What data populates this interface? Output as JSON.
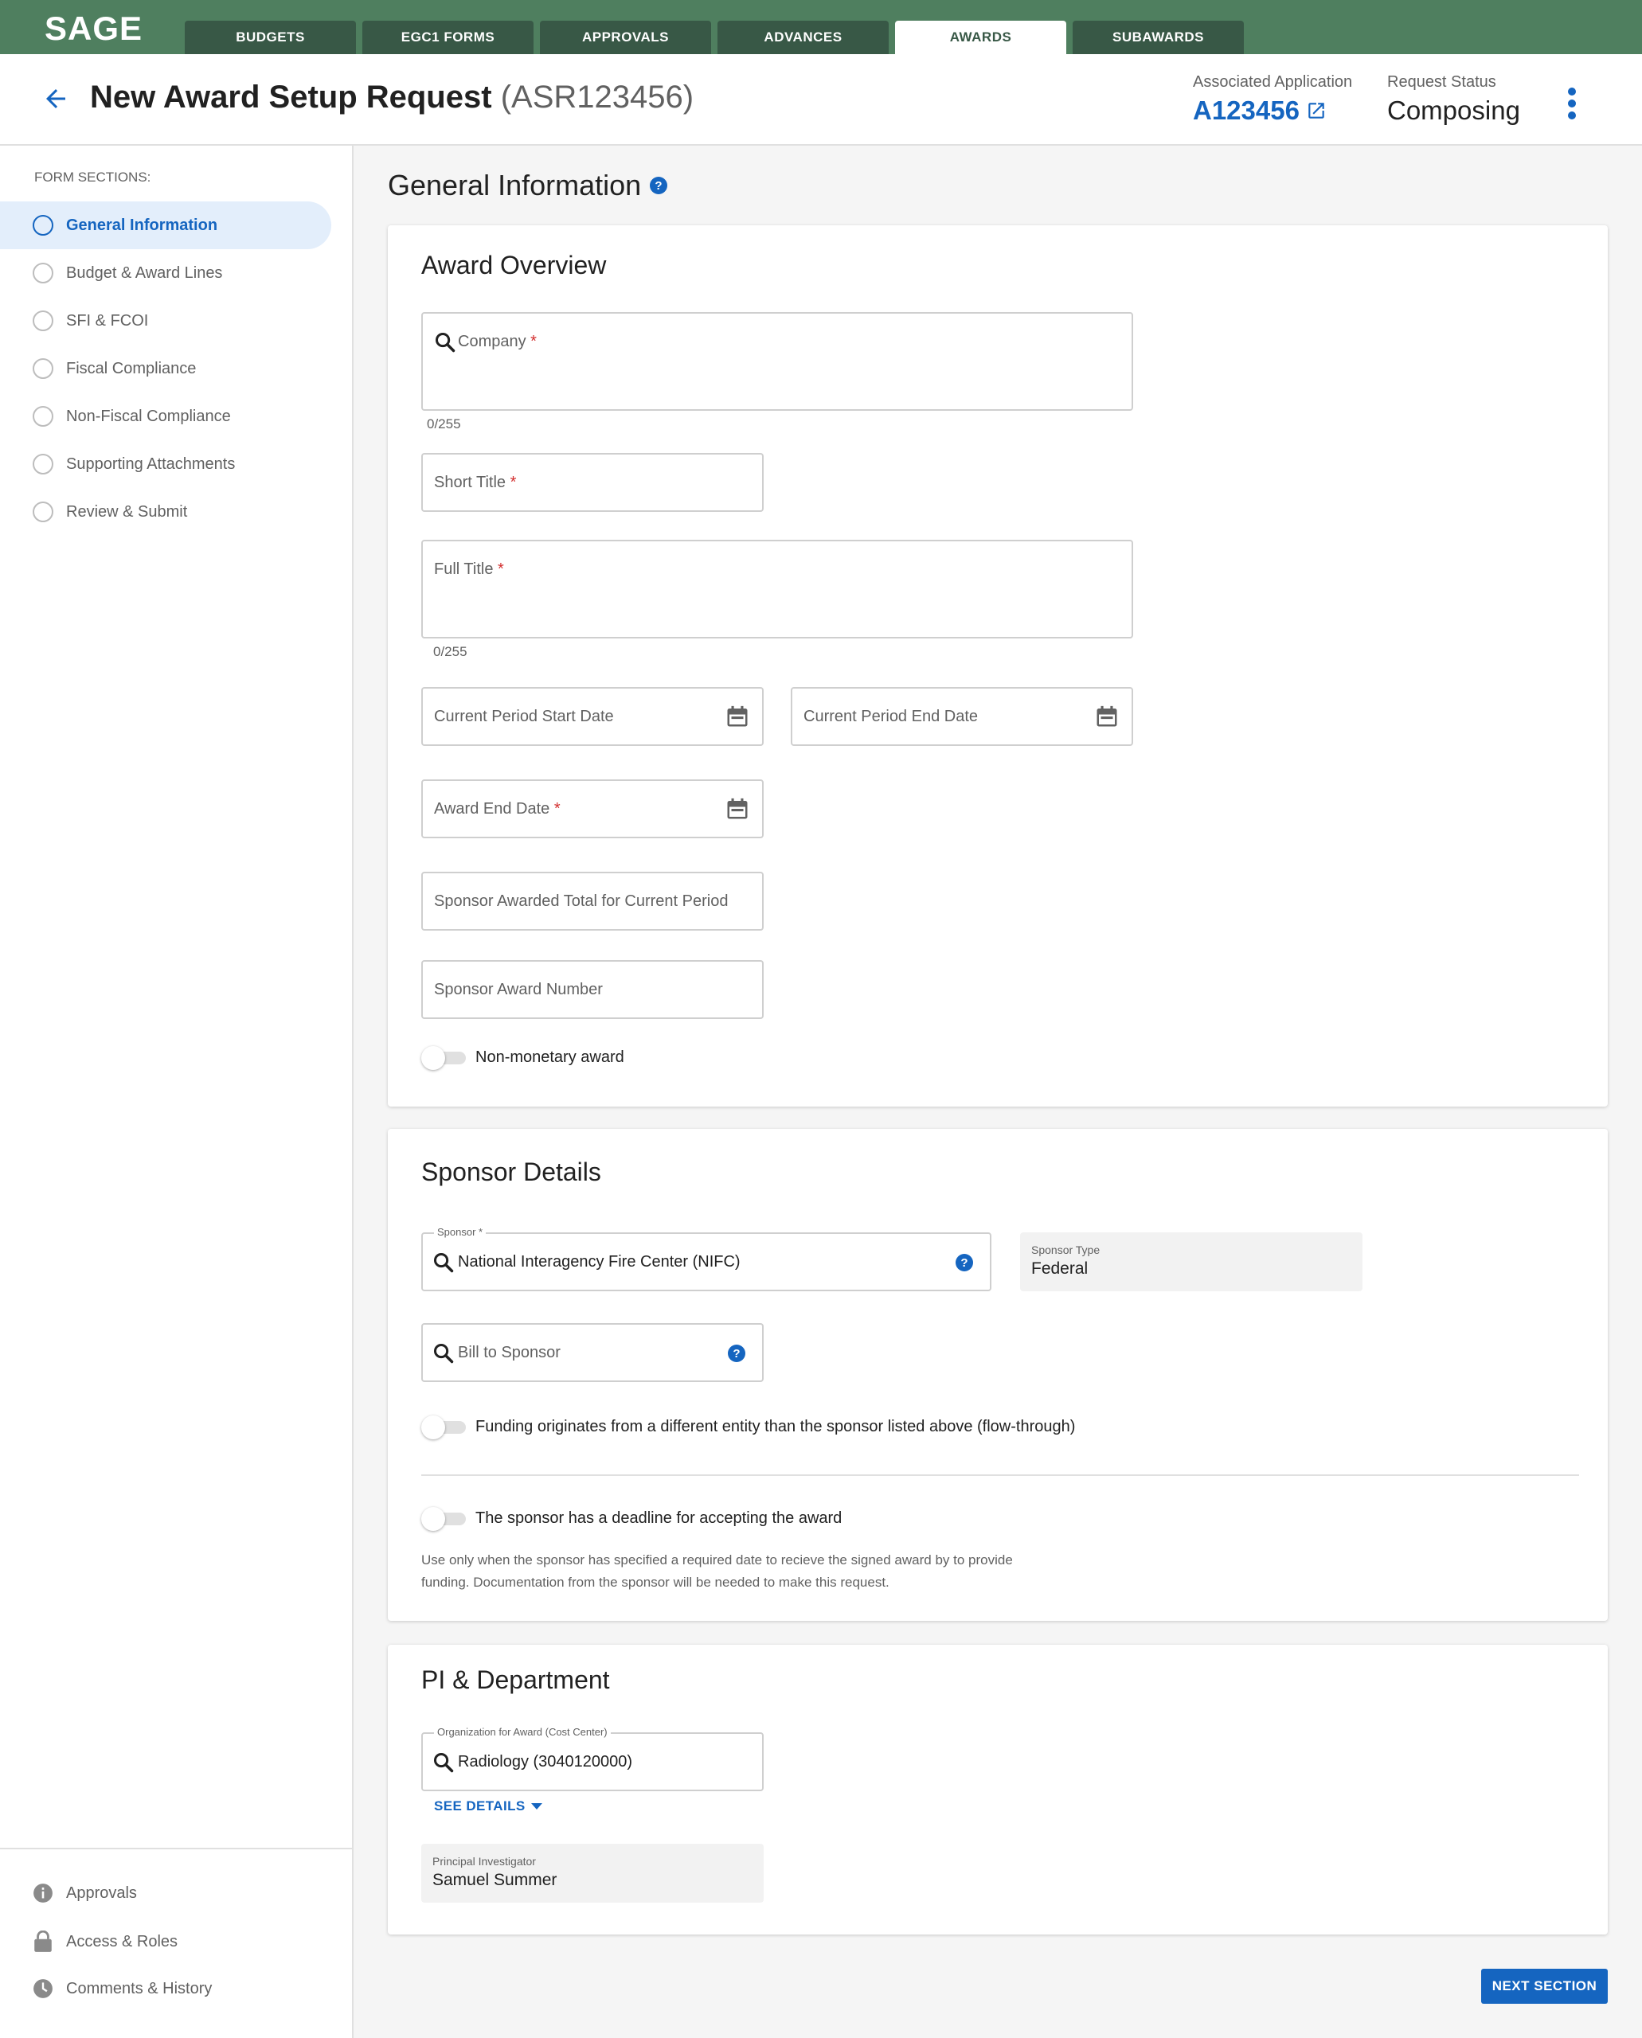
{
  "app": {
    "logo": "SAGE"
  },
  "nav": {
    "tabs": [
      {
        "label": "BUDGETS"
      },
      {
        "label": "EGC1 FORMS"
      },
      {
        "label": "APPROVALS"
      },
      {
        "label": "ADVANCES"
      },
      {
        "label": "AWARDS"
      },
      {
        "label": "SUBAWARDS"
      }
    ],
    "active_tab": "AWARDS"
  },
  "header": {
    "title": "New Award Setup Request",
    "request_id": "(ASR123456)",
    "associated_label": "Associated Application",
    "associated_value": "A123456",
    "status_label": "Request Status",
    "status_value": "Composing"
  },
  "sidebar": {
    "heading": "FORM SECTIONS:",
    "items": [
      {
        "label": "General Information",
        "active": true
      },
      {
        "label": "Budget & Award Lines"
      },
      {
        "label": "SFI & FCOI"
      },
      {
        "label": "Fiscal Compliance"
      },
      {
        "label": "Non-Fiscal Compliance"
      },
      {
        "label": "Supporting Attachments"
      },
      {
        "label": "Review & Submit"
      }
    ],
    "bottom": [
      {
        "label": "Approvals",
        "icon": "info-icon"
      },
      {
        "label": "Access & Roles",
        "icon": "lock-icon"
      },
      {
        "label": "Comments & History",
        "icon": "clock-icon"
      }
    ]
  },
  "main": {
    "section_title": "General Information",
    "overview": {
      "title": "Award Overview",
      "company_label": "Company",
      "company_counter": "0/255",
      "short_title_label": "Short Title",
      "full_title_label": "Full Title",
      "full_title_counter": "0/255",
      "start_date_label": "Current Period Start Date",
      "end_date_label": "Current Period End Date",
      "award_end_label": "Award End Date",
      "sponsor_total_label": "Sponsor Awarded Total for Current Period",
      "sponsor_number_label": "Sponsor Award Number",
      "non_monetary_label": "Non-monetary award",
      "required_mark": "*"
    },
    "sponsor": {
      "title": "Sponsor Details",
      "sponsor_label": "Sponsor *",
      "sponsor_value": "National Interagency Fire Center (NIFC)",
      "type_label": "Sponsor Type",
      "type_value": "Federal",
      "bill_label": "Bill to Sponsor",
      "flow_through_label": "Funding originates from a different entity than the sponsor listed above (flow-through)",
      "deadline_label": "The sponsor has a deadline for accepting the award",
      "deadline_help": "Use only when the sponsor has specified a required date to recieve the signed award by to provide funding. Documentation from the sponsor will be needed to make this request."
    },
    "pi": {
      "title": "PI & Department",
      "org_label": "Organization for Award (Cost Center)",
      "org_value": "Radiology (3040120000)",
      "see_details": "SEE DETAILS",
      "pi_label": "Principal Investigator",
      "pi_value": "Samuel Summer"
    },
    "next_button": "NEXT SECTION"
  },
  "colors": {
    "nav_green": "#4f7f5f",
    "tab_dark": "#385846",
    "accent_blue": "#1565c0",
    "required_red": "#d32f2f"
  }
}
